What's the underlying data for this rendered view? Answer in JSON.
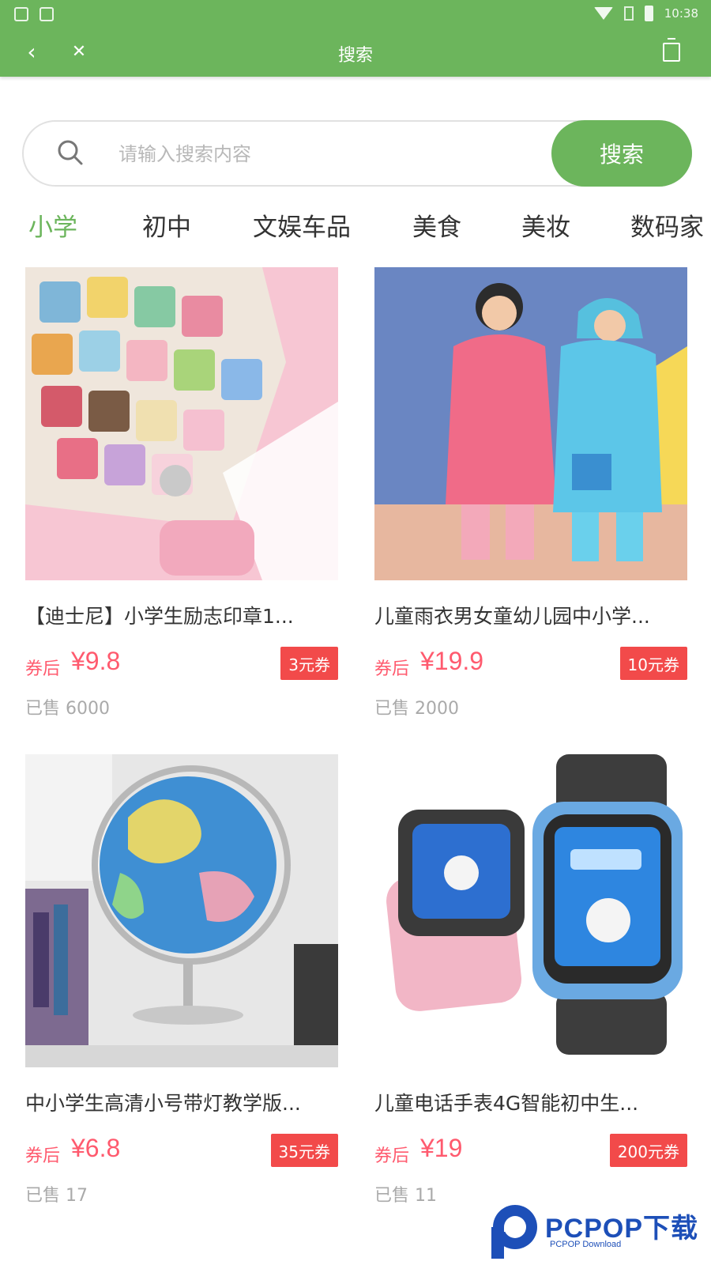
{
  "status_bar": {
    "time": "10:38"
  },
  "nav": {
    "back": "‹",
    "close": "✕",
    "title": "搜索"
  },
  "search": {
    "placeholder": "请输入搜索内容",
    "button": "搜索"
  },
  "tabs": [
    "小学",
    "初中",
    "文娱车品",
    "美食",
    "美妆",
    "数码家"
  ],
  "products": [
    {
      "title": "【迪士尼】小学生励志印章1...",
      "price_label": "券后",
      "price": "¥9.8",
      "coupon": "3元券",
      "sold": "已售 6000"
    },
    {
      "title": "儿童雨衣男女童幼儿园中小学...",
      "price_label": "券后",
      "price": "¥19.9",
      "coupon": "10元券",
      "sold": "已售 2000"
    },
    {
      "title": "中小学生高清小号带灯教学版...",
      "price_label": "券后",
      "price": "¥6.8",
      "coupon": "35元券",
      "sold": "已售 17"
    },
    {
      "title": "儿童电话手表4G智能初中生...",
      "price_label": "券后",
      "price": "¥19",
      "coupon": "200元券",
      "sold": "已售 11"
    }
  ],
  "watermark": {
    "text": "PCPOP下载",
    "sub": "PCPOP Download"
  },
  "colors": {
    "brand_green": "#6cb55c",
    "price_pink": "#ff5a6e",
    "coupon_red": "#f24a4a"
  }
}
